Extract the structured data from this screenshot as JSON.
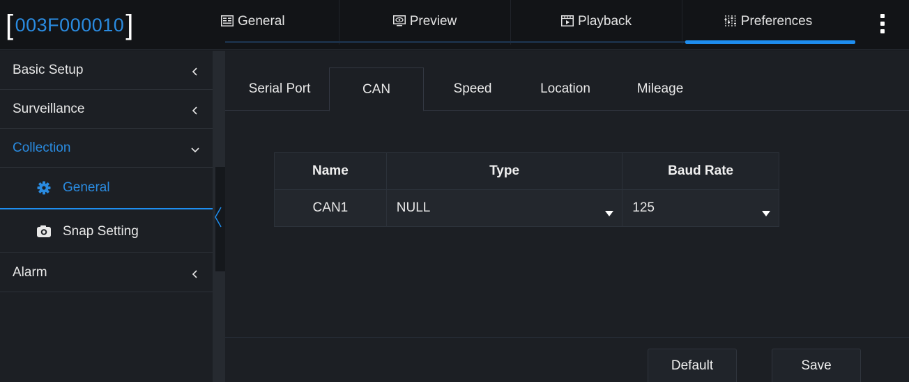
{
  "header": {
    "device_id": "003F000010",
    "tabs": [
      {
        "label": "General",
        "icon": "general-icon"
      },
      {
        "label": "Preview",
        "icon": "preview-icon"
      },
      {
        "label": "Playback",
        "icon": "playback-icon"
      },
      {
        "label": "Preferences",
        "icon": "preferences-icon",
        "active": true
      }
    ],
    "accent_color": "#1e8ef0"
  },
  "sidebar": {
    "items": [
      {
        "label": "Basic Setup",
        "icon": "chevron-left-icon"
      },
      {
        "label": "Surveillance",
        "icon": "chevron-left-icon"
      },
      {
        "label": "Collection",
        "icon": "chevron-down-icon",
        "expanded": true
      },
      {
        "label": "Alarm",
        "icon": "chevron-left-icon"
      }
    ],
    "sub_items": [
      {
        "label": "General",
        "icon": "gear-icon",
        "active": true
      },
      {
        "label": "Snap Setting",
        "icon": "camera-icon"
      }
    ]
  },
  "main": {
    "sub_tabs": [
      {
        "label": "Serial Port"
      },
      {
        "label": "CAN",
        "active": true
      },
      {
        "label": "Speed"
      },
      {
        "label": "Location"
      },
      {
        "label": "Mileage"
      }
    ],
    "table": {
      "headers": [
        "Name",
        "Type",
        "Baud Rate"
      ],
      "rows": [
        {
          "name": "CAN1",
          "type": "NULL",
          "baud_rate": "125"
        }
      ]
    },
    "buttons": {
      "default": "Default",
      "save": "Save"
    }
  }
}
